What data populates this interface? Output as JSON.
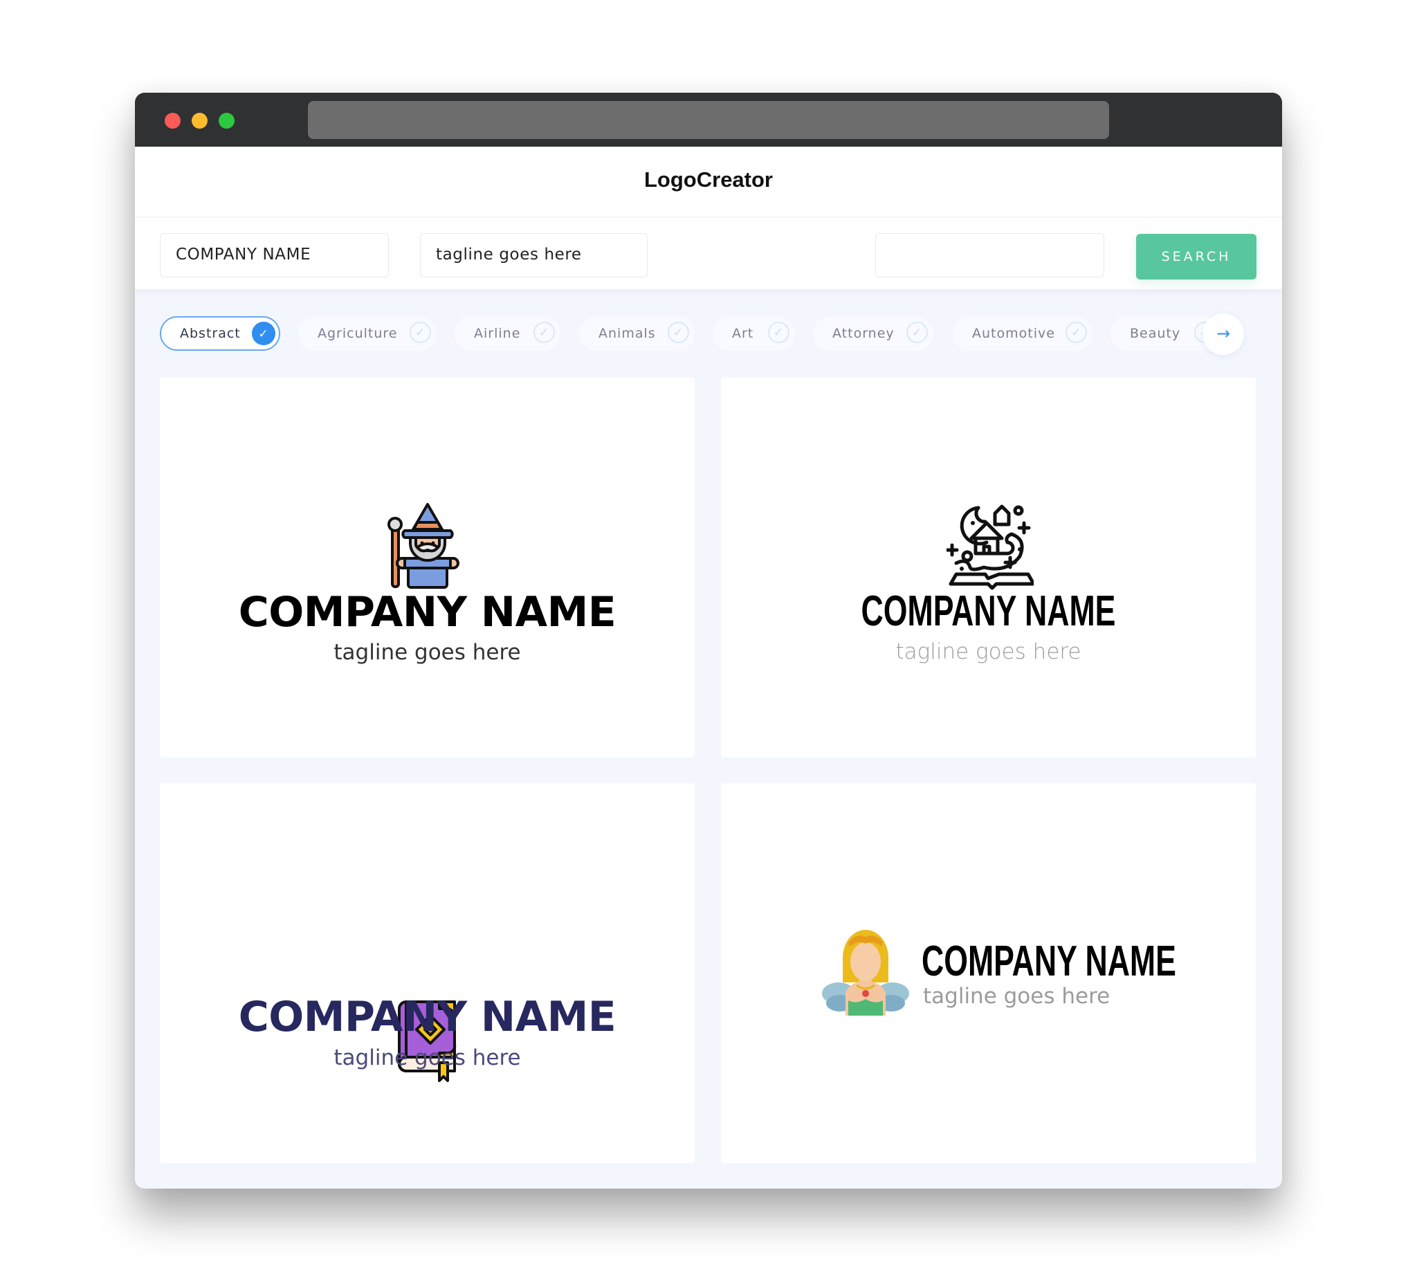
{
  "app": {
    "title": "LogoCreator"
  },
  "window": {
    "controls": [
      "close",
      "minimize",
      "maximize"
    ],
    "url": ""
  },
  "toolbar": {
    "company_name_value": "COMPANY NAME",
    "tagline_value": "tagline goes here",
    "extra_field_value": "",
    "search_label": "SEARCH",
    "accent_color": "#58c79e"
  },
  "categories": {
    "items": [
      {
        "label": "Abstract",
        "selected": true
      },
      {
        "label": "Agriculture",
        "selected": false
      },
      {
        "label": "Airline",
        "selected": false
      },
      {
        "label": "Animals",
        "selected": false
      },
      {
        "label": "Art",
        "selected": false
      },
      {
        "label": "Attorney",
        "selected": false
      },
      {
        "label": "Automotive",
        "selected": false
      },
      {
        "label": "Beauty",
        "selected": false
      }
    ],
    "check_glyph": "✓",
    "next_glyph": "→",
    "selected_color": "#2f8ef0"
  },
  "logos": [
    {
      "icon": "wizard-icon",
      "company": "COMPANY NAME",
      "tagline": "tagline goes here",
      "color": "#000000"
    },
    {
      "icon": "fairytale-book-icon",
      "company": "COMPANY NAME",
      "tagline": "tagline goes here",
      "color": "#000000"
    },
    {
      "icon": "magic-book-icon",
      "company": "COMPANY NAME",
      "tagline": "tagline goes here",
      "color": "#27285f"
    },
    {
      "icon": "fairy-icon",
      "company": "COMPANY NAME",
      "tagline": "tagline goes here",
      "color": "#000000"
    }
  ]
}
